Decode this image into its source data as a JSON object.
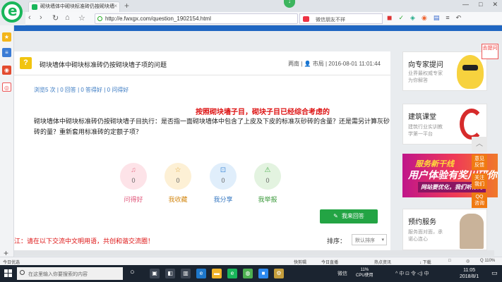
{
  "browser": {
    "tab_title": "砌块墙体中砌块标准砖仍按砌块墙",
    "url": "http://e.fwxgx.com/question_1902154.html",
    "search_placeholder": "微信朋友不祥",
    "back_icon": "‹",
    "forward_icon": "›",
    "reload_icon": "↻",
    "home_icon": "⌂",
    "star_icon": "☆",
    "new_tab_icon": "+",
    "minimize_icon": "—",
    "maximize_icon": "□",
    "close_icon": "✕"
  },
  "question": {
    "icon": "?",
    "title": "砌块墙体中砌块标准砖仍按砌块墙子项的问题",
    "author": "两南",
    "meta_sep": "| 👤 市局 | 2016-08-01 11:01:44",
    "stats": "浏览5 次 | 0 回答 | 0 答得好 | 0 问得好",
    "highlight": "按照砌块墙子目，砌块子目已经综合考虑的",
    "body": "砌块墙体中砌块标准砖仍按砌块墙子目执行：是否指一面砌块墙体中包含了上皮及下皮的标准灰砂砖的含量？还是需另计算灰砂砖的量？重新套用标准砖的定额子项？"
  },
  "actions": [
    {
      "label": "问得好",
      "count": "0",
      "icon": "♫"
    },
    {
      "label": "我收藏",
      "count": "0",
      "icon": "☆"
    },
    {
      "label": "我分享",
      "count": "0",
      "icon": "⊡"
    },
    {
      "label": "我举报",
      "count": "0",
      "icon": "⚠"
    }
  ],
  "answer_button": "我来回答",
  "banner_text": "江：请在以下交流中文明用语，共创和谐交流圈！",
  "sort": {
    "label": "排序：",
    "value": "默认排序"
  },
  "sidebar": {
    "expert_title": "向专家提问",
    "expert_sub": "业界最权威专家\n为你解答",
    "jump_label": "去提问",
    "course_title": "建筑课堂",
    "course_sub": "建筑行业实训教\n学第一平台",
    "promo_line1": "服务新干线",
    "promo_line2": "用户体验有奖川研你",
    "promo_line3": "网站要优化，我们听你的",
    "booking_title": "预约服务",
    "booking_sub": "服务面对面，承\n诺心连心",
    "float_buttons": [
      "意见\n反馈",
      "关注\n我们",
      "QQ\n咨询"
    ]
  },
  "status": {
    "left": "今日优选",
    "items": [
      "快剪辑",
      "今日直播",
      "热点资讯",
      "↓ 下载",
      "□",
      "◎",
      "Q 110%"
    ]
  },
  "taskbar": {
    "search_placeholder": "在这里输入你要搜索的内容",
    "cpu": "11%\nCPU使用",
    "tray_text": "^ 中 ⊡ 令 ◁) 中",
    "time": "11:05",
    "date": "2018/8/1"
  }
}
